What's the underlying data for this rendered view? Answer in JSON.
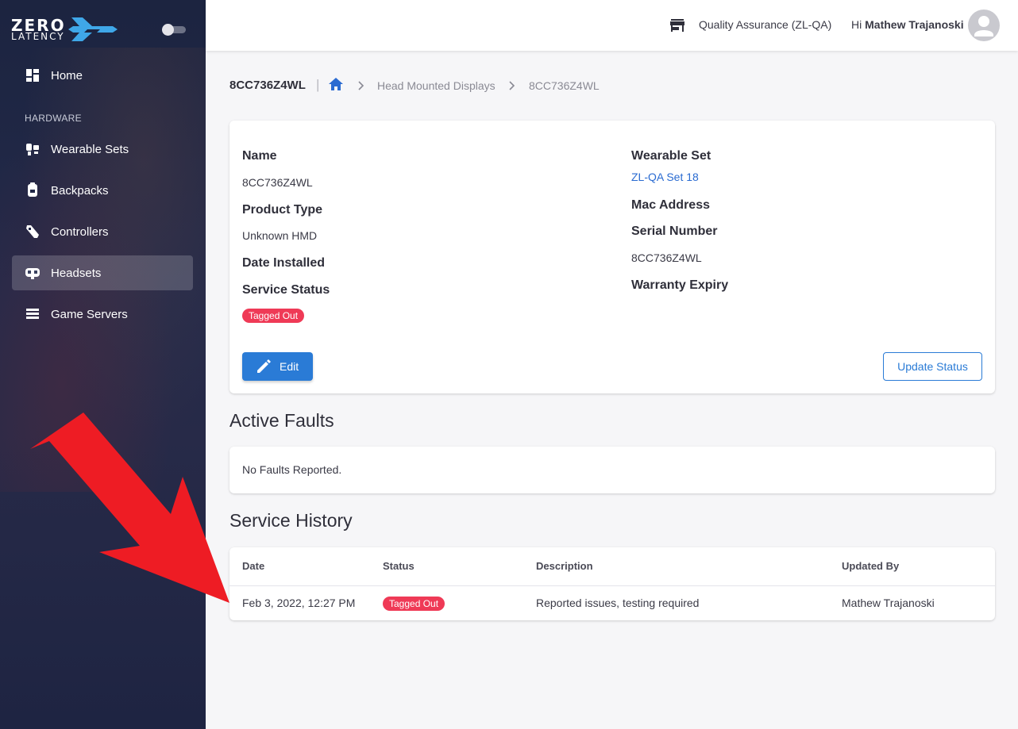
{
  "brand": {
    "line1": "ZERO",
    "line2": "LATENCY"
  },
  "sidebar": {
    "items": [
      {
        "label": "Home",
        "icon": "dashboard-icon"
      },
      {
        "label": "Wearable Sets",
        "icon": "wearable-icon"
      },
      {
        "label": "Backpacks",
        "icon": "backpack-icon"
      },
      {
        "label": "Controllers",
        "icon": "controller-icon"
      },
      {
        "label": "Headsets",
        "icon": "headset-icon",
        "active": true
      },
      {
        "label": "Game Servers",
        "icon": "server-icon"
      }
    ],
    "section_hardware": "HARDWARE"
  },
  "topbar": {
    "site": "Quality Assurance (ZL-QA)",
    "greeting": "Hi",
    "user_name": "Mathew Trajanoski"
  },
  "breadcrumb": {
    "title": "8CC736Z4WL",
    "separator": "|",
    "link": "Head Mounted Displays",
    "current": "8CC736Z4WL"
  },
  "details": {
    "name_label": "Name",
    "name_value": "8CC736Z4WL",
    "product_type_label": "Product Type",
    "product_type_value": "Unknown HMD",
    "date_installed_label": "Date Installed",
    "service_status_label": "Service Status",
    "service_status_value": "Tagged Out",
    "wearable_set_label": "Wearable Set",
    "wearable_set_value": "ZL-QA Set 18",
    "mac_address_label": "Mac Address",
    "serial_number_label": "Serial Number",
    "serial_number_value": "8CC736Z4WL",
    "warranty_expiry_label": "Warranty Expiry",
    "edit_label": "Edit",
    "update_status_label": "Update Status"
  },
  "faults": {
    "title": "Active Faults",
    "empty_text": "No Faults Reported."
  },
  "history": {
    "title": "Service History",
    "columns": [
      "Date",
      "Status",
      "Description",
      "Updated By"
    ],
    "rows": [
      {
        "date": "Feb 3, 2022, 12:27 PM",
        "status": "Tagged Out",
        "description": "Reported issues, testing required",
        "updated_by": "Mathew Trajanoski"
      }
    ]
  },
  "colors": {
    "accent": "#2a7bd6",
    "badge": "#ef3a56",
    "sidebar": "#1f2645",
    "annotation_arrow": "#ee1c24"
  }
}
